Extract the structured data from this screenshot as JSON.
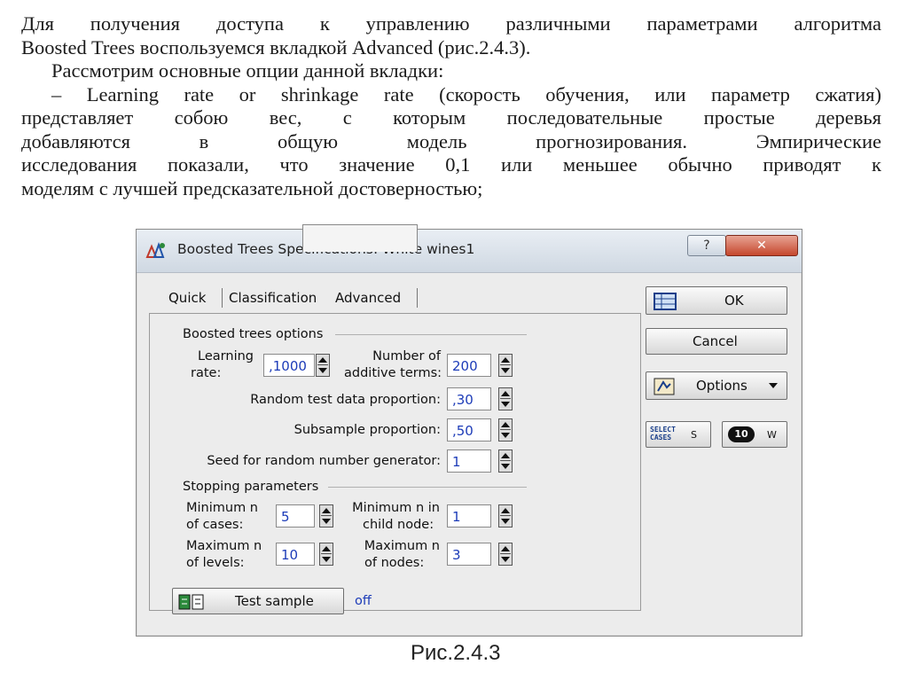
{
  "document": {
    "paragraph1_line1": "Для получения доступа к управлению различными параметрами алгоритма",
    "paragraph1_line2": "Boosted Trees воспользуемся вкладкой Advanced (рис.2.4.3).",
    "paragraph2": "Рассмотрим основные опции данной вкладки:",
    "paragraph3_line1": "– Learning rate or shrinkage rate (скорость обучения, или параметр сжатия)",
    "paragraph3_line2": "представляет собою вес,  с которым последовательные простые деревья",
    "paragraph3_line3": "добавляются в общую модель прогнозирования. Эмпирические",
    "paragraph3_line4": "исследования показали, что значение 0,1 или меньшее обычно приводят к",
    "paragraph3_line5": "моделям с лучшей предсказательной достоверностью;",
    "caption": "Рис.2.4.3"
  },
  "dialog": {
    "title": "Boosted Trees Specifications: White wines1",
    "help_label": "?",
    "close_label": "✕",
    "tabs": [
      "Quick",
      "Classification",
      "Advanced"
    ],
    "active_tab": "Advanced",
    "boosted_group_title": "Boosted trees options",
    "learning_rate_label_1": "Learning",
    "learning_rate_label_2": "rate:",
    "learning_rate_value": ",1000",
    "additive_terms_label_1": "Number of",
    "additive_terms_label_2": "additive terms:",
    "additive_terms_value": "200",
    "random_test_label": "Random test data proportion:",
    "random_test_value": ",30",
    "subsample_label": "Subsample proportion:",
    "subsample_value": ",50",
    "seed_label": "Seed for random number generator:",
    "seed_value": "1",
    "stopping_group_title": "Stopping parameters",
    "min_cases_label_1": "Minimum n",
    "min_cases_label_2": "of cases:",
    "min_cases_value": "5",
    "min_child_label_1": "Minimum n in",
    "min_child_label_2": "child node:",
    "min_child_value": "1",
    "max_levels_label_1": "Maximum n",
    "max_levels_label_2": "of levels:",
    "max_levels_value": "10",
    "max_nodes_label_1": "Maximum n",
    "max_nodes_label_2": "of nodes:",
    "max_nodes_value": "3",
    "test_sample_label": "Test sample",
    "test_sample_status": "off",
    "ok_label": "OK",
    "cancel_label": "Cancel",
    "options_label": "Options",
    "select_cases_label_1": "SELECT",
    "select_cases_label_2": "CASES",
    "select_cases_suffix": "S",
    "weight_icon_text": "10",
    "weight_suffix": "W"
  },
  "colors": {
    "field_text": "#1d3cb8",
    "status_text": "#1d3cb8",
    "title_bar": "#cfd8e2",
    "close_button": "#c5472d"
  },
  "icons": [
    "boosted-trees-app-icon",
    "ok-table-icon",
    "options-icon",
    "dropdown-arrow-icon",
    "select-cases-icon",
    "weight-icon",
    "test-sample-icon"
  ]
}
